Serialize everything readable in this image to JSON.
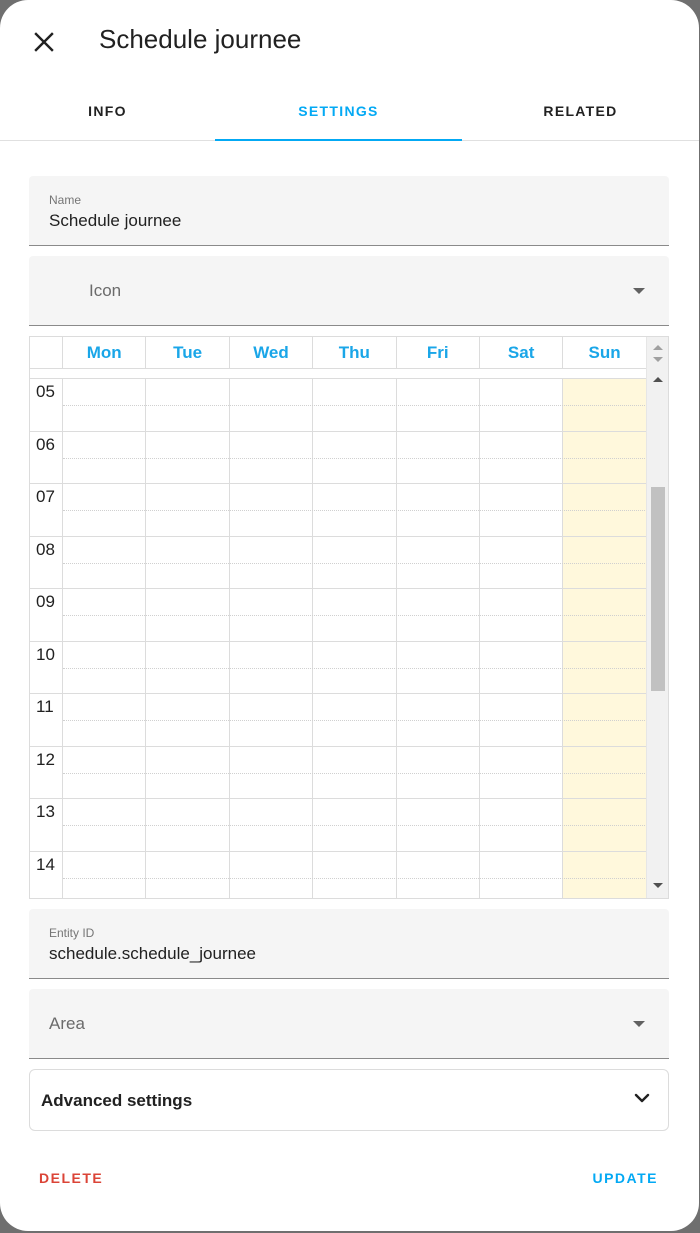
{
  "dialog": {
    "title": "Schedule journee",
    "close_icon": "close-icon"
  },
  "tabs": [
    {
      "label": "INFO",
      "active": false
    },
    {
      "label": "SETTINGS",
      "active": true
    },
    {
      "label": "RELATED",
      "active": false
    }
  ],
  "form": {
    "name_label": "Name",
    "name_value": "Schedule journee",
    "icon_placeholder": "Icon",
    "entity_label": "Entity ID",
    "entity_value": "schedule.schedule_journee",
    "area_placeholder": "Area",
    "advanced_label": "Advanced settings"
  },
  "schedule": {
    "days": [
      "Mon",
      "Tue",
      "Wed",
      "Thu",
      "Fri",
      "Sat",
      "Sun"
    ],
    "highlighted_day": "Sun",
    "hours": [
      "05",
      "06",
      "07",
      "08",
      "09",
      "10",
      "11",
      "12",
      "13",
      "14"
    ]
  },
  "actions": {
    "delete_label": "DELETE",
    "update_label": "UPDATE"
  },
  "colors": {
    "accent": "#03a9f4",
    "day_header": "#1aa6e8",
    "danger": "#db4437",
    "today_bg": "#fff8dc"
  }
}
